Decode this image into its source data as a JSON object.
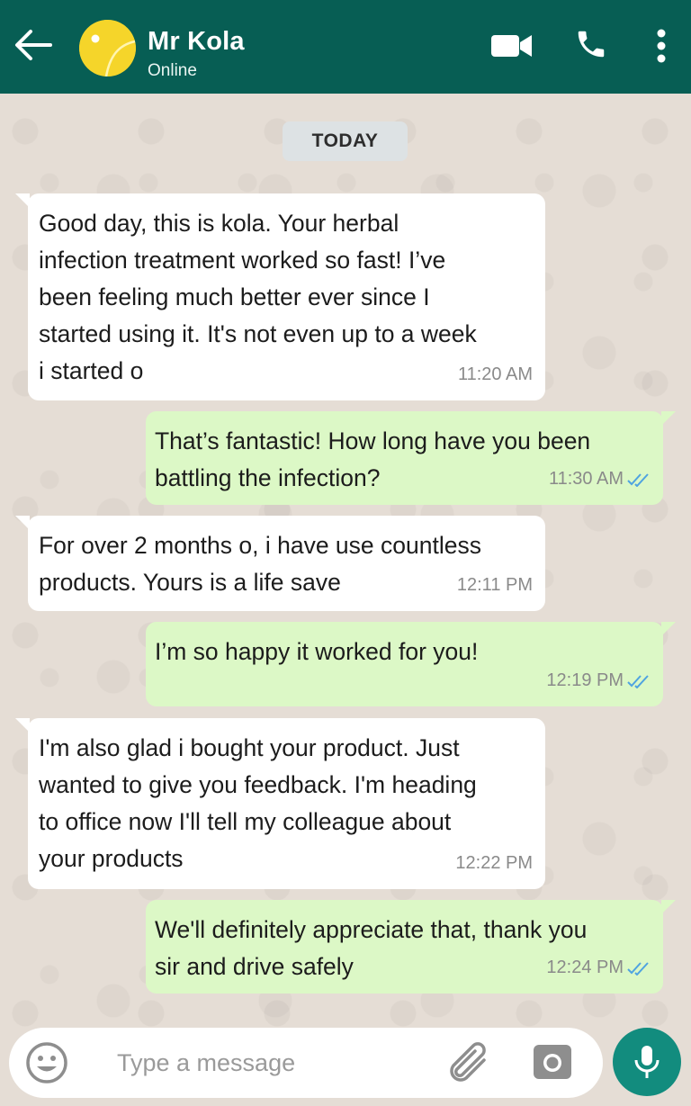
{
  "header": {
    "contact_name": "Mr Kola",
    "status": "Online",
    "icons": [
      "back-arrow-icon",
      "video-call-icon",
      "phone-icon",
      "more-vertical-icon"
    ],
    "color": "#075e54"
  },
  "chat": {
    "date_label": "TODAY",
    "messages": [
      {
        "direction": "incoming",
        "text": "Good day, this is kola. Your herbal\ninfection treatment worked so fast! I’ve\nbeen feeling much better ever since I\nstarted using it. It's not even up to a week\ni started o",
        "time": "11:20 AM"
      },
      {
        "direction": "outgoing",
        "text": "That’s fantastic! How long have you been\nbattling the infection?",
        "time": "11:30 AM",
        "read": true
      },
      {
        "direction": "incoming",
        "text": "For over 2 months o, i have use countless\nproducts. Yours is a life save",
        "time": "12:11 PM"
      },
      {
        "direction": "outgoing",
        "text": "I’m so happy it worked for you!",
        "time": "12:19 PM",
        "read": true
      },
      {
        "direction": "incoming",
        "text": "I'm also glad i bought your product. Just\nwanted to give you feedback. I'm heading\nto office now I'll tell my colleague about\nyour products",
        "time": "12:22 PM"
      },
      {
        "direction": "outgoing",
        "text": "We'll definitely appreciate that, thank you\nsir and drive safely",
        "time": "12:24 PM",
        "read": true
      }
    ],
    "colors": {
      "incoming": "#ffffff",
      "outgoing": "#dcf8c6",
      "read_ticks": "#4fa3e0"
    }
  },
  "composer": {
    "placeholder": "Type a message",
    "icons": [
      "emoji-icon",
      "attach-icon",
      "camera-icon",
      "mic-icon"
    ],
    "mic_color": "#128c7e"
  }
}
